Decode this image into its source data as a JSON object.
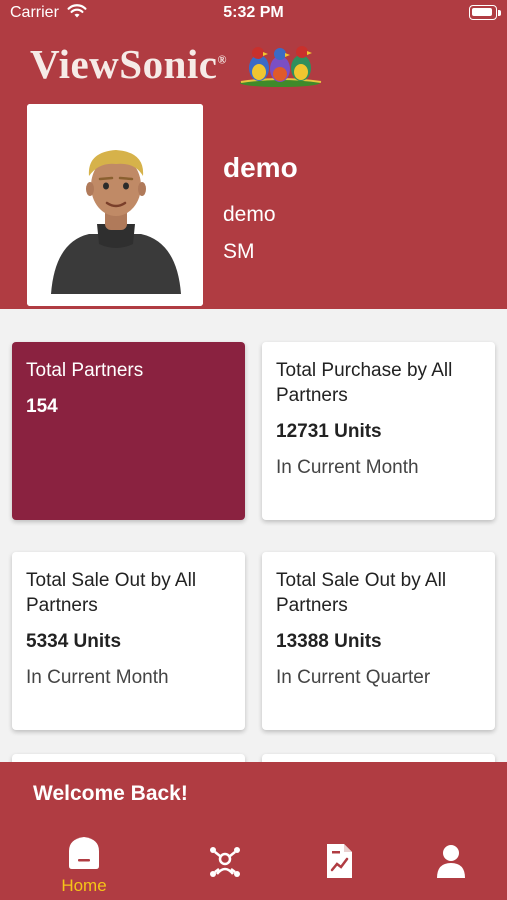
{
  "status_bar": {
    "carrier": "Carrier",
    "time": "5:32 PM"
  },
  "brand": {
    "name": "ViewSonic",
    "trademark": "®"
  },
  "profile": {
    "name": "demo",
    "username": "demo",
    "role": "SM"
  },
  "cards": [
    {
      "title": "Total Partners",
      "value": "154",
      "subtitle": "",
      "highlight": true
    },
    {
      "title": "Total Purchase by All Partners",
      "value": "12731 Units",
      "subtitle": "In Current Month",
      "highlight": false
    },
    {
      "title": "Total Sale Out by All Partners",
      "value": "5334 Units",
      "subtitle": "In Current Month",
      "highlight": false
    },
    {
      "title": "Total Sale Out by All Partners",
      "value": "13388 Units",
      "subtitle": "In Current Quarter",
      "highlight": false
    }
  ],
  "welcome": "Welcome Back!",
  "tabs": [
    {
      "icon": "home-icon",
      "label": "Home",
      "active": true
    },
    {
      "icon": "partners-icon",
      "label": "",
      "active": false
    },
    {
      "icon": "report-icon",
      "label": "",
      "active": false
    },
    {
      "icon": "profile-icon",
      "label": "",
      "active": false
    }
  ],
  "colors": {
    "header": "#b03c42",
    "highlight_card": "#8a2240",
    "active_tab": "#f5c518",
    "background": "#f2f2f2"
  }
}
